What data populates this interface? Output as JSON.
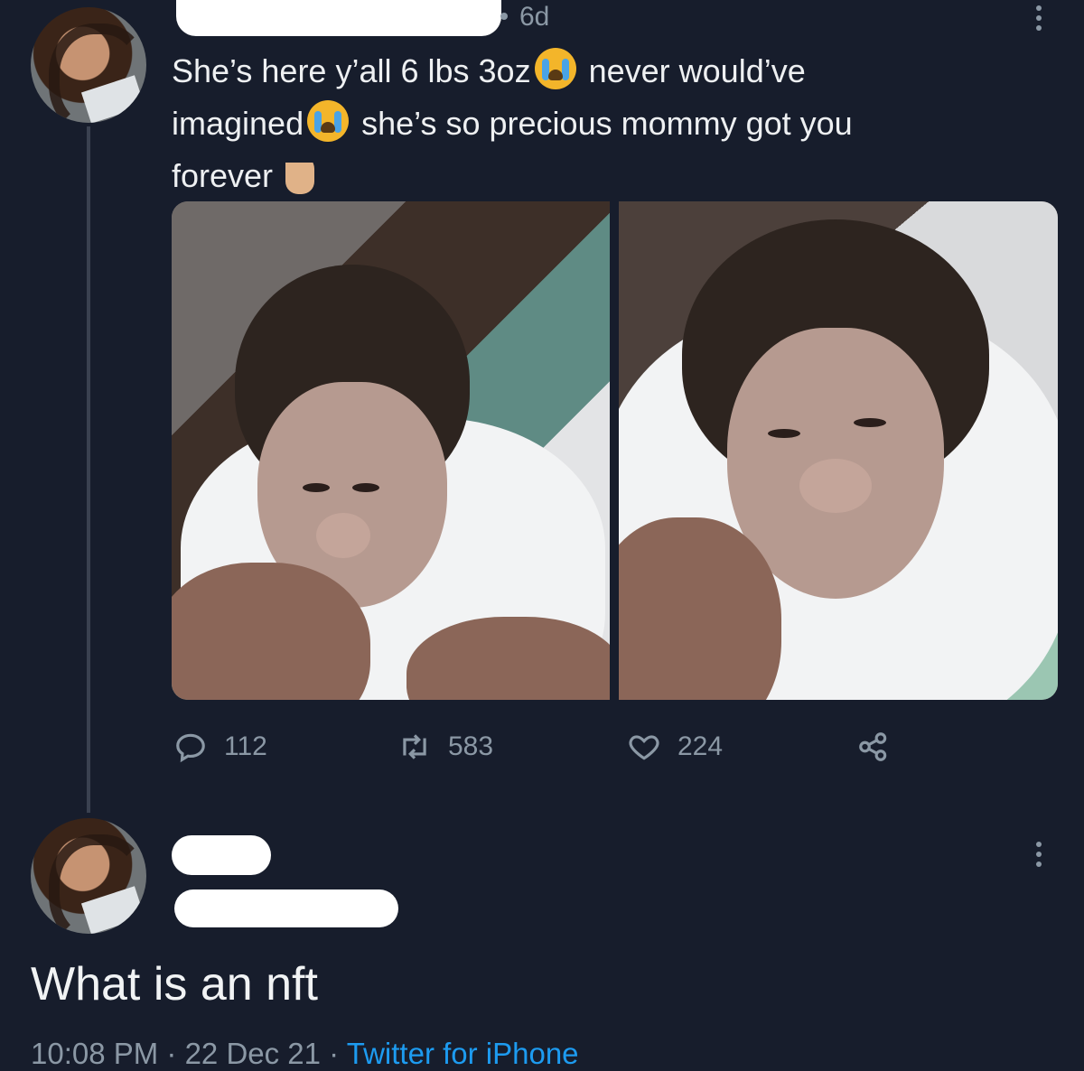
{
  "tweet": {
    "time": "6d",
    "text_1": "She’s here y’all 6 lbs  3oz",
    "text_2": "never would’ve",
    "text_3": "imagined",
    "text_4": "she’s so precious mommy got you",
    "text_5": "forever",
    "emoji_crying": "loudly-crying-face-emoji",
    "emoji_hand": "crossed-fingers-emoji"
  },
  "actions": {
    "reply_count": "112",
    "retweet_count": "583",
    "like_count": "224",
    "reply_icon": "reply-icon",
    "retweet_icon": "retweet-icon",
    "like_icon": "heart-icon",
    "share_icon": "share-icon"
  },
  "reply": {
    "text": "What is an nft",
    "time": "10:08 PM · 22 Dec 21 · ",
    "source": "Twitter for iPhone"
  },
  "colors": {
    "background": "#171d2c",
    "text": "#e7e9ea",
    "muted": "#8b98a5",
    "link": "#1d9bf0"
  }
}
